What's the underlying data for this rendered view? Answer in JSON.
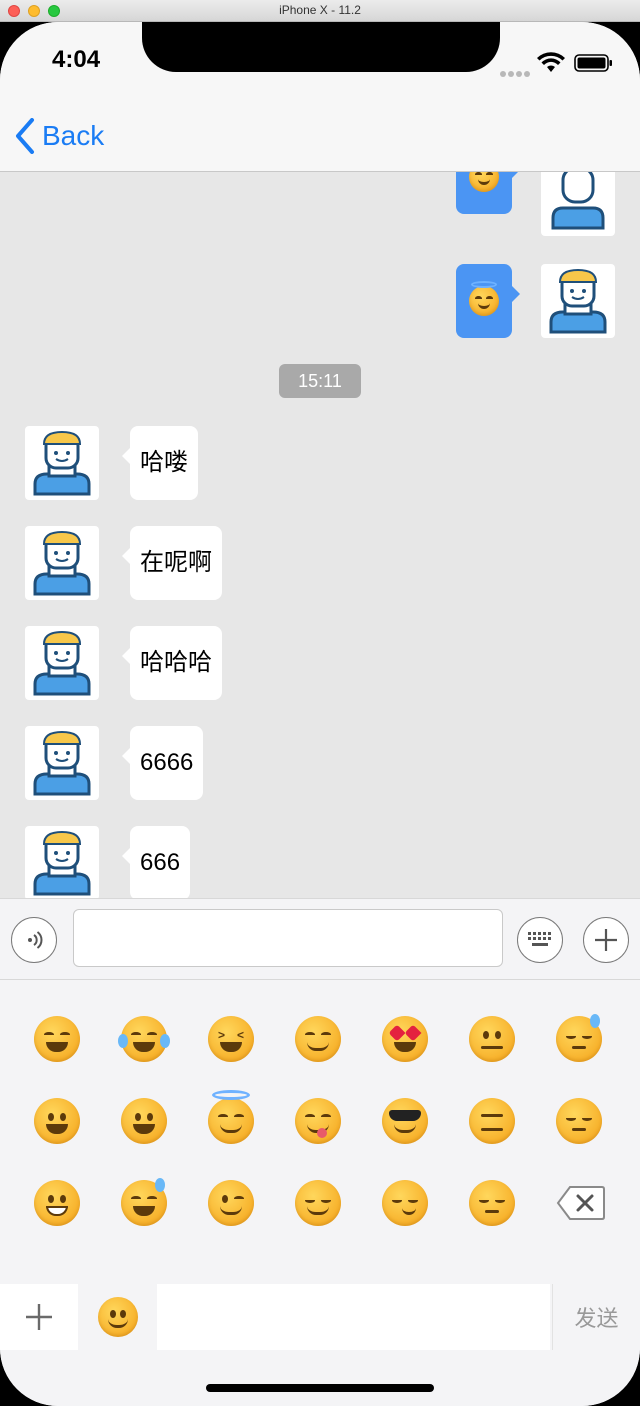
{
  "window": {
    "title": "iPhone X - 11.2"
  },
  "status_bar": {
    "time": "4:04"
  },
  "nav": {
    "back_label": "Back"
  },
  "messages": {
    "timestamp": "15:11",
    "incoming": [
      {
        "text": "哈喽"
      },
      {
        "text": "在呢啊"
      },
      {
        "text": "哈哈哈"
      },
      {
        "text": "6666"
      },
      {
        "text": "666"
      }
    ],
    "outgoing": [
      {
        "content": "relieved-emoji"
      },
      {
        "content": "halo-emoji"
      }
    ]
  },
  "emoji_panel": {
    "rows": [
      [
        "grin",
        "joy",
        "laughing",
        "blush",
        "heart-eyes",
        "neutral",
        "sweat"
      ],
      [
        "grinning",
        "smiley",
        "innocent",
        "yum",
        "sunglasses",
        "expressionless",
        "pensive"
      ],
      [
        "grin-teeth",
        "sweat-smile",
        "wink",
        "relieved",
        "smirk",
        "unamused",
        "delete"
      ]
    ],
    "pages": 7,
    "active_page": 1
  },
  "bottom_bar": {
    "send_label": "发送"
  },
  "colors": {
    "accent": "#1a7cf4",
    "outgoing_bubble": "#4b95f3",
    "background": "#e7e7e7"
  }
}
